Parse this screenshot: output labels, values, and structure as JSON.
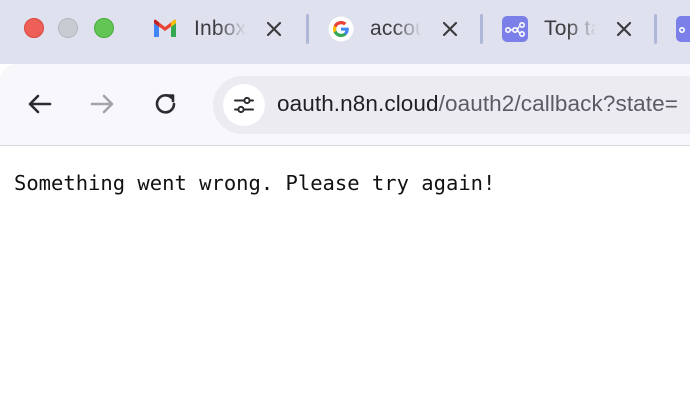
{
  "browser": {
    "tabs": [
      {
        "title": "Inbox",
        "icon": "gmail-icon"
      },
      {
        "title": "account",
        "icon": "google-icon"
      },
      {
        "title": "Top tags",
        "icon": "n8n-icon"
      },
      {
        "title": "",
        "icon": "n8n-icon"
      }
    ],
    "address_bar": {
      "host": "oauth.n8n.cloud",
      "path": "/oauth2/callback?state="
    }
  },
  "page": {
    "message": "Something went wrong. Please try again!"
  },
  "colors": {
    "tabstrip_bg": "#dfe2ee",
    "toolbar_bg": "#f8f7fb",
    "omnibox_bg": "#ecebf2",
    "n8n_purple": "#7b7fe8",
    "close_red": "#ee5f57",
    "minimize_gray": "#c9cbd3",
    "maximize_green": "#62c554"
  }
}
